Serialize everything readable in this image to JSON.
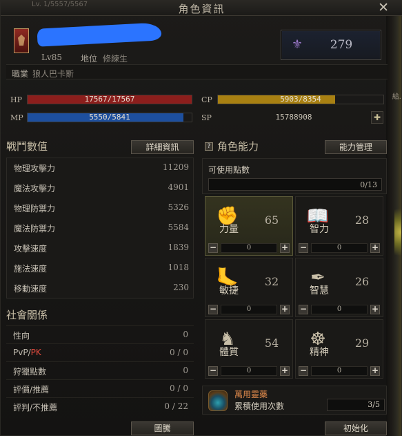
{
  "window": {
    "title": "角色資訊",
    "ghost_text": "Lv. 1/5557/5567",
    "edge_text": "給."
  },
  "profile": {
    "level": "Lv85",
    "rank_label": "地位",
    "rank_value": "修練生",
    "job_label": "職業",
    "job_value": "狼人巴卡斯",
    "score": "279"
  },
  "vitals": {
    "hp_label": "HP",
    "hp_text": "17567/17567",
    "hp_ratio": 1.0,
    "hp_color": "#8c1e1c",
    "mp_label": "MP",
    "mp_text": "5550/5841",
    "mp_ratio": 0.95,
    "mp_color": "#1d4f9e",
    "cp_label": "CP",
    "cp_text": "5903/8354",
    "cp_ratio": 0.707,
    "cp_color": "#a88012",
    "sp_label": "SP",
    "sp_text": "15788908"
  },
  "combat": {
    "title": "戰鬥數值",
    "details_button": "詳細資訊",
    "stats": [
      {
        "name": "物理攻擊力",
        "value": "11209"
      },
      {
        "name": "魔法攻擊力",
        "value": "4901"
      },
      {
        "name": "物理防禦力",
        "value": "5326"
      },
      {
        "name": "魔法防禦力",
        "value": "5584"
      },
      {
        "name": "攻擊速度",
        "value": "1839"
      },
      {
        "name": "施法速度",
        "value": "1018"
      },
      {
        "name": "移動速度",
        "value": "230"
      }
    ]
  },
  "social": {
    "title": "社會關係",
    "rows": [
      {
        "name": "性向",
        "value": "0"
      },
      {
        "name_a": "PvP/",
        "name_b": "PK",
        "value": "0 / 0"
      },
      {
        "name": "狩獵點數",
        "value": "0"
      },
      {
        "name": "評價/推薦",
        "value": "0 / 0"
      },
      {
        "name": "評判/不推薦",
        "value": "0 / 22"
      }
    ],
    "button": "圖騰"
  },
  "abilities": {
    "title": "角色能力",
    "manage_button": "能力管理",
    "points_label": "可使用點數",
    "points_value": "0/13",
    "cells": [
      {
        "name": "力量",
        "value": "65",
        "step": "0",
        "icon": "fist-icon"
      },
      {
        "name": "智力",
        "value": "28",
        "step": "0",
        "icon": "book-icon"
      },
      {
        "name": "敏捷",
        "value": "32",
        "step": "0",
        "icon": "foot-icon"
      },
      {
        "name": "智慧",
        "value": "26",
        "step": "0",
        "icon": "quill-icon"
      },
      {
        "name": "體質",
        "value": "54",
        "step": "0",
        "icon": "torso-icon"
      },
      {
        "name": "精神",
        "value": "29",
        "step": "0",
        "icon": "mind-icon"
      }
    ],
    "potion_name": "萬用靈藥",
    "potion_label": "累積使用次數",
    "potion_count": "3/5",
    "reset_button": "初始化"
  }
}
